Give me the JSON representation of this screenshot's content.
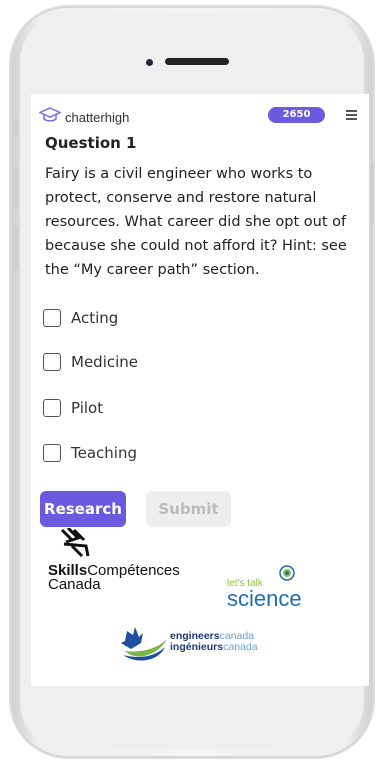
{
  "app": {
    "name": "chatterhigh",
    "score": "2650"
  },
  "question": {
    "title": "Question 1",
    "text": "Fairy is a civil engineer who works to protect, conserve and restore natural resources. What career did she opt out of because she could not afford it? Hint: see the “My career path” section."
  },
  "options": [
    {
      "label": "Acting",
      "checked": false
    },
    {
      "label": "Medicine",
      "checked": false
    },
    {
      "label": "Pilot",
      "checked": false
    },
    {
      "label": "Teaching",
      "checked": false
    }
  ],
  "buttons": {
    "research": "Research",
    "submit": "Submit"
  },
  "sponsors": {
    "skills_bold": "Skills",
    "skills_rest": "Compétences",
    "skills_line2": "Canada",
    "lts_small": "let's talk",
    "lts_big": "science",
    "eng_line1_bold": "engineers",
    "eng_line1_rest": "canada",
    "eng_line2_bold": "ingénieurs",
    "eng_line2_rest": "canada"
  },
  "colors": {
    "accent": "#6a5ae0",
    "submit_disabled_bg": "#eeeeee",
    "lts_green": "#8cc63f",
    "lts_blue": "#1f6fb2"
  },
  "icons": {
    "logo": "graduation-cap-icon",
    "menu": "hamburger-menu-icon"
  }
}
